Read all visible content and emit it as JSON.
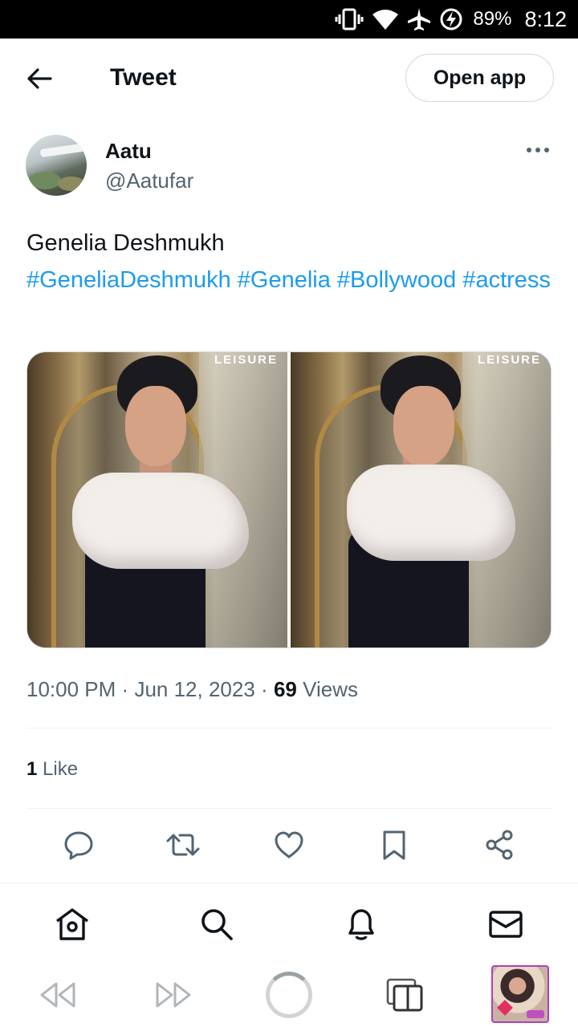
{
  "status_bar": {
    "battery": "89%",
    "time": "8:12",
    "icons": [
      "vibrate-icon",
      "wifi-icon",
      "airplane-mode-icon",
      "battery-charging-icon"
    ]
  },
  "header": {
    "title": "Tweet",
    "open_app_label": "Open app"
  },
  "author": {
    "name": "Aatu",
    "handle": "@Aatufar"
  },
  "tweet": {
    "text": "Genelia Deshmukh",
    "hashtags": [
      "#GeneliaDeshmukh",
      "#Genelia",
      "#Bollywood",
      "#actress"
    ],
    "media": [
      {
        "brand": "LEISURE"
      },
      {
        "brand": "LEISURE"
      }
    ]
  },
  "meta": {
    "time": "10:00 PM",
    "date": "Jun 12, 2023",
    "views_count": "69",
    "views_label": "Views",
    "separator": "·"
  },
  "engagement": {
    "likes_count": "1",
    "likes_label": "Like"
  },
  "actions": [
    "reply-icon",
    "retweet-icon",
    "like-icon",
    "bookmark-icon",
    "share-icon"
  ],
  "bottom_nav": [
    "home-icon",
    "search-icon",
    "notifications-icon",
    "messages-icon"
  ],
  "browser_bar": [
    "rewind-icon",
    "fast-forward-icon",
    "loading-indicator",
    "tabs-icon",
    "page-thumbnail"
  ],
  "colors": {
    "link": "#1d9bf0",
    "secondary_text": "#536471",
    "primary_text": "#0f1419",
    "border": "#cfd9de"
  }
}
